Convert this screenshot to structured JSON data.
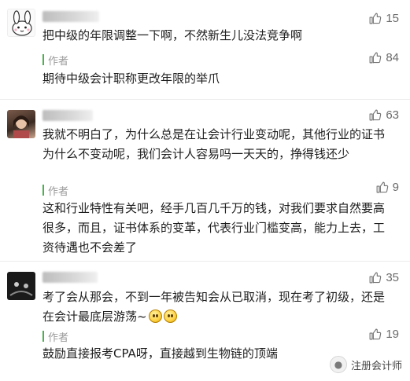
{
  "comments": [
    {
      "text": "把中级的年限调整一下啊，不然新生儿没法竞争啊",
      "likes": "15",
      "author_label": "作者",
      "author_reply": "期待中级会计职称更改年限的举爪",
      "author_likes": "84"
    },
    {
      "text": "我就不明白了，为什么总是在让会计行业变动呢，其他行业的证书为什么不变动呢，我们会计人容易吗一天天的，挣得钱还少",
      "likes": "63",
      "author_label": "作者",
      "author_reply": "这和行业特性有关吧，经手几百几千万的钱，对我们要求自然要高很多，而且，证书体系的变革，代表行业门槛变高，能力上去，工资待遇也不会差了",
      "author_likes": "9"
    },
    {
      "text": "考了会从那会，不到一年被告知会从已取消，现在考了初级，还是在会计最底层游荡~",
      "likes": "35",
      "author_label": "作者",
      "author_reply": "鼓励直接报考CPA呀，直接越到生物链的顶端",
      "author_likes": "19"
    }
  ],
  "watermark": "注册会计师",
  "icons": {
    "like": "thumbs-up-icon",
    "emoji": "smile-emoji-icon",
    "watermark": "wechat-icon"
  },
  "colors": {
    "author_bar": "#4caf50",
    "like_text": "#6b6b6b"
  }
}
